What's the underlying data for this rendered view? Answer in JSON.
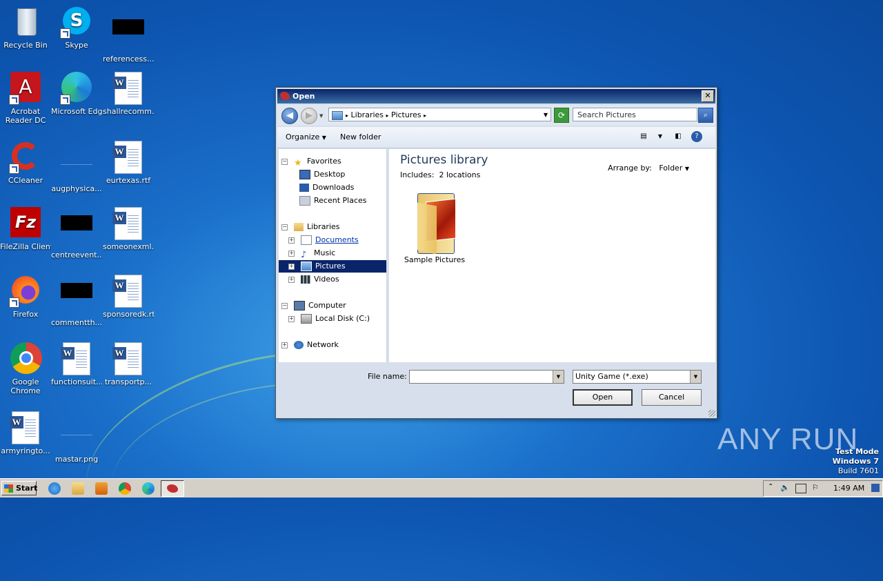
{
  "desktop": {
    "icons": [
      {
        "label": "Recycle Bin"
      },
      {
        "label": "Skype"
      },
      {
        "label": "referencess..."
      },
      {
        "label": "Acrobat Reader DC"
      },
      {
        "label": "Microsoft Edge"
      },
      {
        "label": "shallrecomm..."
      },
      {
        "label": "CCleaner"
      },
      {
        "label": "augphysica..."
      },
      {
        "label": "eurtexas.rtf"
      },
      {
        "label": "FileZilla Client"
      },
      {
        "label": "centreevent..."
      },
      {
        "label": "someonexml..."
      },
      {
        "label": "Firefox"
      },
      {
        "label": "commentth..."
      },
      {
        "label": "sponsoredk.rtf"
      },
      {
        "label": "Google Chrome"
      },
      {
        "label": "functionsuit..."
      },
      {
        "label": "transportp..."
      },
      {
        "label": "armyringto..."
      },
      {
        "label": "mastar.png"
      }
    ],
    "watermark": "ANY RUN",
    "test_mode": [
      "Test Mode",
      "Windows 7",
      "Build 7601"
    ]
  },
  "dialog": {
    "title": "Open",
    "breadcrumb": [
      "Libraries",
      "Pictures"
    ],
    "search_placeholder": "Search Pictures",
    "toolbar": {
      "organize": "Organize",
      "new_folder": "New folder"
    },
    "nav": {
      "favorites": "Favorites",
      "desktop": "Desktop",
      "downloads": "Downloads",
      "recent": "Recent Places",
      "libraries": "Libraries",
      "documents": "Documents",
      "music": "Music",
      "pictures": "Pictures",
      "videos": "Videos",
      "computer": "Computer",
      "localdisk": "Local Disk (C:)",
      "network": "Network"
    },
    "content": {
      "title": "Pictures library",
      "includes_label": "Includes:",
      "includes_value": "2 locations",
      "arrange_label": "Arrange by:",
      "arrange_value": "Folder",
      "items": [
        {
          "label": "Sample Pictures"
        }
      ]
    },
    "filename_label": "File name:",
    "filename_value": "",
    "filetype_value": "Unity Game (*.exe)",
    "open_label": "Open",
    "cancel_label": "Cancel"
  },
  "taskbar": {
    "start_label": "Start",
    "clock": "1:49 AM"
  }
}
